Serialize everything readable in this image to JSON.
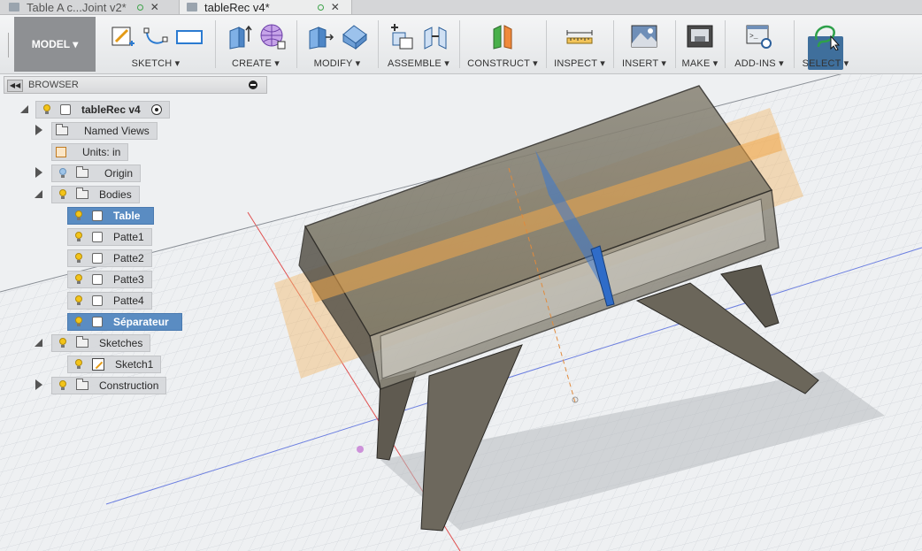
{
  "tabs": [
    {
      "label": "Table A c...Joint v2*",
      "active": false
    },
    {
      "label": "tableRec v4*",
      "active": true
    }
  ],
  "toolbar": {
    "workspace": "MODEL ▾",
    "groups": [
      {
        "label": "SKETCH ▾"
      },
      {
        "label": "CREATE ▾"
      },
      {
        "label": "MODIFY ▾"
      },
      {
        "label": "ASSEMBLE ▾"
      },
      {
        "label": "CONSTRUCT ▾"
      },
      {
        "label": "INSPECT ▾"
      },
      {
        "label": "INSERT ▾"
      },
      {
        "label": "MAKE ▾"
      },
      {
        "label": "ADD-INS ▾"
      },
      {
        "label": "SELECT ▾"
      }
    ]
  },
  "browser": {
    "title": "BROWSER",
    "root": "tableRec v4",
    "nodes": [
      {
        "label": "Named Views"
      },
      {
        "label": "Units: in"
      },
      {
        "label": "Origin"
      },
      {
        "label": "Bodies"
      },
      {
        "label": "Table"
      },
      {
        "label": "Patte1"
      },
      {
        "label": "Patte2"
      },
      {
        "label": "Patte3"
      },
      {
        "label": "Patte4"
      },
      {
        "label": "Séparateur"
      },
      {
        "label": "Sketches"
      },
      {
        "label": "Sketch1"
      },
      {
        "label": "Construction"
      }
    ]
  },
  "colors": {
    "accent": "#5a8cc2",
    "select_active": "#3f6f9c",
    "construction_plane": "#f2b86a",
    "separator": "#3a78d0",
    "body": "#6f6a5e"
  },
  "icons": [
    "cube-icon",
    "status-dot-icon",
    "close-icon",
    "sketch-icon",
    "arc-icon",
    "rectangle-icon",
    "extrude-icon",
    "form-icon",
    "press-pull-icon",
    "fillet-icon",
    "new-component-icon",
    "joint-icon",
    "construct-plane-icon",
    "measure-icon",
    "insert-image-icon",
    "print-3d-icon",
    "scripts-icon",
    "select-lasso-icon",
    "bulb-icon",
    "folder-icon",
    "units-icon",
    "body-icon",
    "sketch-item-icon",
    "radio-icon"
  ]
}
